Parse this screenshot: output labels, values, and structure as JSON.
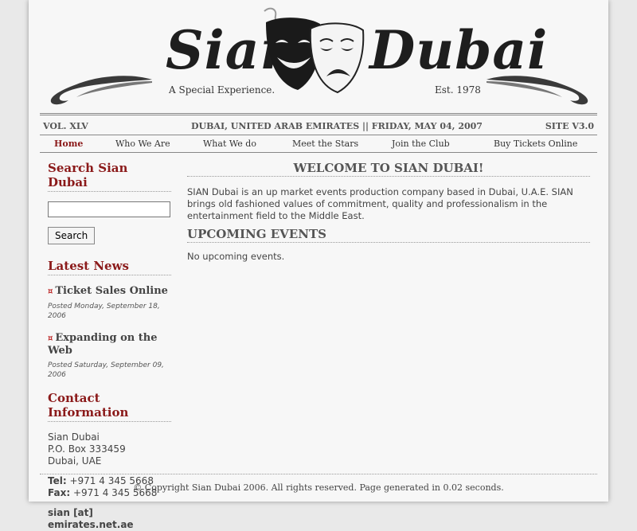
{
  "header": {
    "logo_left": "Sian",
    "logo_right": "Dubai",
    "tagline": "A Special Experience.",
    "established": "Est. 1978"
  },
  "infobar": {
    "volume": "VOL. XLV",
    "dateline": "DUBAI, UNITED ARAB EMIRATES || FRIDAY, MAY 04, 2007",
    "site_version": "SITE V3.0"
  },
  "nav": {
    "items": [
      {
        "label": "Home",
        "active": true
      },
      {
        "label": "Who We Are"
      },
      {
        "label": "What We do"
      },
      {
        "label": "Meet the Stars"
      },
      {
        "label": "Join the Club"
      },
      {
        "label": "Buy Tickets Online"
      }
    ]
  },
  "sidebar": {
    "search_heading": "Search Sian Dubai",
    "search_value": "",
    "search_button": "Search",
    "news_heading": "Latest News",
    "news": [
      {
        "title": "Ticket Sales Online",
        "date": "Posted Monday, September 18, 2006"
      },
      {
        "title": "Expanding on the Web",
        "date": "Posted Saturday, September 09, 2006"
      }
    ],
    "contact_heading": "Contact Information",
    "address": [
      "Sian Dubai",
      "P.O. Box 333459",
      "Dubai, UAE"
    ],
    "tel_label": "Tel:",
    "tel": " +971 4 345 5668",
    "fax_label": "Fax:",
    "fax": " +971 4 345 5668",
    "email": "sian [at] emirates.net.ae"
  },
  "main": {
    "welcome_title": "WELCOME TO SIAN DUBAI!",
    "intro": "SIAN Dubai is an up market events production company based in Dubai, U.A.E. SIAN brings old fashioned values of commitment, quality and professionalism in the entertainment field to the Middle East.",
    "events_title": "UPCOMING EVENTS",
    "no_events": "No upcoming events."
  },
  "footer": {
    "text": "© Copyright Sian Dubai 2006. All rights reserved. Page generated in 0.02 seconds."
  },
  "colors": {
    "accent": "#8b1a1a",
    "page_bg": "#f7f7f7",
    "body_bg": "#e9e9e9"
  }
}
